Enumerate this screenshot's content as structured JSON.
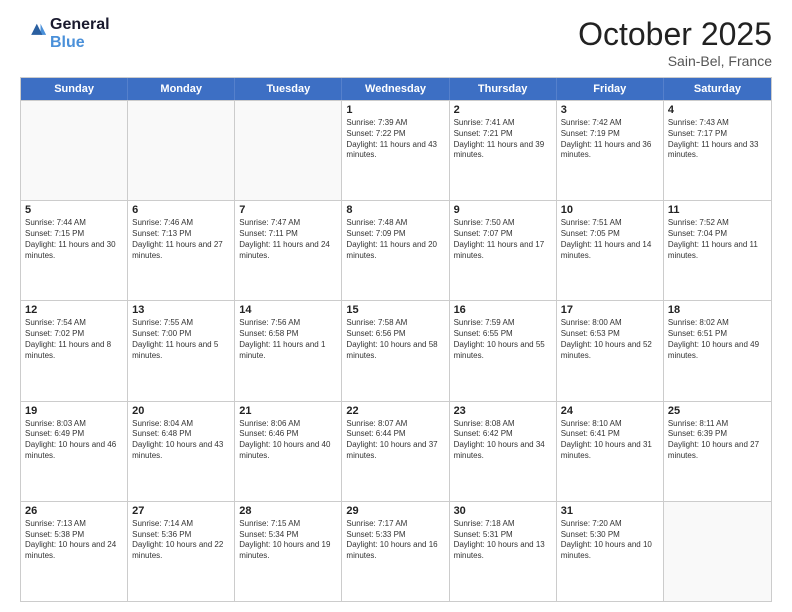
{
  "header": {
    "logo_line1": "General",
    "logo_line2": "Blue",
    "month": "October 2025",
    "location": "Sain-Bel, France"
  },
  "weekdays": [
    "Sunday",
    "Monday",
    "Tuesday",
    "Wednesday",
    "Thursday",
    "Friday",
    "Saturday"
  ],
  "rows": [
    [
      {
        "day": "",
        "text": "",
        "empty": true
      },
      {
        "day": "",
        "text": "",
        "empty": true
      },
      {
        "day": "",
        "text": "",
        "empty": true
      },
      {
        "day": "1",
        "text": "Sunrise: 7:39 AM\nSunset: 7:22 PM\nDaylight: 11 hours and 43 minutes."
      },
      {
        "day": "2",
        "text": "Sunrise: 7:41 AM\nSunset: 7:21 PM\nDaylight: 11 hours and 39 minutes."
      },
      {
        "day": "3",
        "text": "Sunrise: 7:42 AM\nSunset: 7:19 PM\nDaylight: 11 hours and 36 minutes."
      },
      {
        "day": "4",
        "text": "Sunrise: 7:43 AM\nSunset: 7:17 PM\nDaylight: 11 hours and 33 minutes."
      }
    ],
    [
      {
        "day": "5",
        "text": "Sunrise: 7:44 AM\nSunset: 7:15 PM\nDaylight: 11 hours and 30 minutes."
      },
      {
        "day": "6",
        "text": "Sunrise: 7:46 AM\nSunset: 7:13 PM\nDaylight: 11 hours and 27 minutes."
      },
      {
        "day": "7",
        "text": "Sunrise: 7:47 AM\nSunset: 7:11 PM\nDaylight: 11 hours and 24 minutes."
      },
      {
        "day": "8",
        "text": "Sunrise: 7:48 AM\nSunset: 7:09 PM\nDaylight: 11 hours and 20 minutes."
      },
      {
        "day": "9",
        "text": "Sunrise: 7:50 AM\nSunset: 7:07 PM\nDaylight: 11 hours and 17 minutes."
      },
      {
        "day": "10",
        "text": "Sunrise: 7:51 AM\nSunset: 7:05 PM\nDaylight: 11 hours and 14 minutes."
      },
      {
        "day": "11",
        "text": "Sunrise: 7:52 AM\nSunset: 7:04 PM\nDaylight: 11 hours and 11 minutes."
      }
    ],
    [
      {
        "day": "12",
        "text": "Sunrise: 7:54 AM\nSunset: 7:02 PM\nDaylight: 11 hours and 8 minutes."
      },
      {
        "day": "13",
        "text": "Sunrise: 7:55 AM\nSunset: 7:00 PM\nDaylight: 11 hours and 5 minutes."
      },
      {
        "day": "14",
        "text": "Sunrise: 7:56 AM\nSunset: 6:58 PM\nDaylight: 11 hours and 1 minute."
      },
      {
        "day": "15",
        "text": "Sunrise: 7:58 AM\nSunset: 6:56 PM\nDaylight: 10 hours and 58 minutes."
      },
      {
        "day": "16",
        "text": "Sunrise: 7:59 AM\nSunset: 6:55 PM\nDaylight: 10 hours and 55 minutes."
      },
      {
        "day": "17",
        "text": "Sunrise: 8:00 AM\nSunset: 6:53 PM\nDaylight: 10 hours and 52 minutes."
      },
      {
        "day": "18",
        "text": "Sunrise: 8:02 AM\nSunset: 6:51 PM\nDaylight: 10 hours and 49 minutes."
      }
    ],
    [
      {
        "day": "19",
        "text": "Sunrise: 8:03 AM\nSunset: 6:49 PM\nDaylight: 10 hours and 46 minutes."
      },
      {
        "day": "20",
        "text": "Sunrise: 8:04 AM\nSunset: 6:48 PM\nDaylight: 10 hours and 43 minutes."
      },
      {
        "day": "21",
        "text": "Sunrise: 8:06 AM\nSunset: 6:46 PM\nDaylight: 10 hours and 40 minutes."
      },
      {
        "day": "22",
        "text": "Sunrise: 8:07 AM\nSunset: 6:44 PM\nDaylight: 10 hours and 37 minutes."
      },
      {
        "day": "23",
        "text": "Sunrise: 8:08 AM\nSunset: 6:42 PM\nDaylight: 10 hours and 34 minutes."
      },
      {
        "day": "24",
        "text": "Sunrise: 8:10 AM\nSunset: 6:41 PM\nDaylight: 10 hours and 31 minutes."
      },
      {
        "day": "25",
        "text": "Sunrise: 8:11 AM\nSunset: 6:39 PM\nDaylight: 10 hours and 27 minutes."
      }
    ],
    [
      {
        "day": "26",
        "text": "Sunrise: 7:13 AM\nSunset: 5:38 PM\nDaylight: 10 hours and 24 minutes."
      },
      {
        "day": "27",
        "text": "Sunrise: 7:14 AM\nSunset: 5:36 PM\nDaylight: 10 hours and 22 minutes."
      },
      {
        "day": "28",
        "text": "Sunrise: 7:15 AM\nSunset: 5:34 PM\nDaylight: 10 hours and 19 minutes."
      },
      {
        "day": "29",
        "text": "Sunrise: 7:17 AM\nSunset: 5:33 PM\nDaylight: 10 hours and 16 minutes."
      },
      {
        "day": "30",
        "text": "Sunrise: 7:18 AM\nSunset: 5:31 PM\nDaylight: 10 hours and 13 minutes."
      },
      {
        "day": "31",
        "text": "Sunrise: 7:20 AM\nSunset: 5:30 PM\nDaylight: 10 hours and 10 minutes."
      },
      {
        "day": "",
        "text": "",
        "empty": true
      }
    ]
  ]
}
